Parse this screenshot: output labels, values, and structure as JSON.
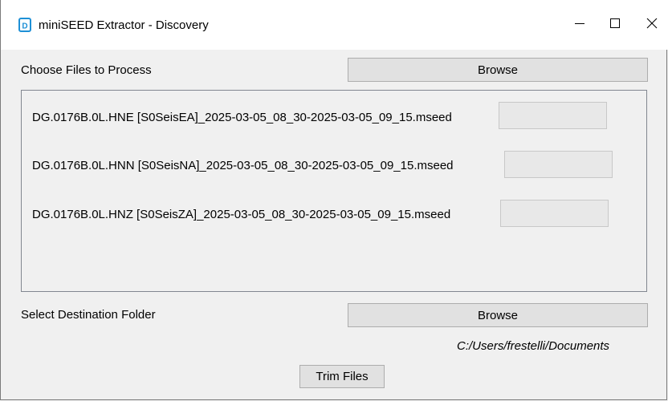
{
  "window": {
    "title": "miniSEED Extractor - Discovery",
    "icon": "app-d-icon",
    "controls": {
      "minimize": "minimize-icon",
      "maximize": "maximize-icon",
      "close": "close-icon"
    }
  },
  "choose_files": {
    "label": "Choose Files to Process",
    "browse_label": "Browse"
  },
  "files": [
    "DG.0176B.0L.HNE [S0SeisEA]_2025-03-05_08_30-2025-03-05_09_15.mseed",
    "DG.0176B.0L.HNN [S0SeisNA]_2025-03-05_08_30-2025-03-05_09_15.mseed",
    "DG.0176B.0L.HNZ [S0SeisZA]_2025-03-05_08_30-2025-03-05_09_15.mseed"
  ],
  "destination": {
    "label": "Select Destination Folder",
    "browse_label": "Browse",
    "path": "C:/Users/frestelli/Documents"
  },
  "actions": {
    "trim_label": "Trim Files"
  },
  "colors": {
    "window_bg": "#f0f0f0",
    "titlebar_bg": "#ffffff",
    "button_bg": "#e1e1e1",
    "icon_accent": "#1e90d6"
  }
}
